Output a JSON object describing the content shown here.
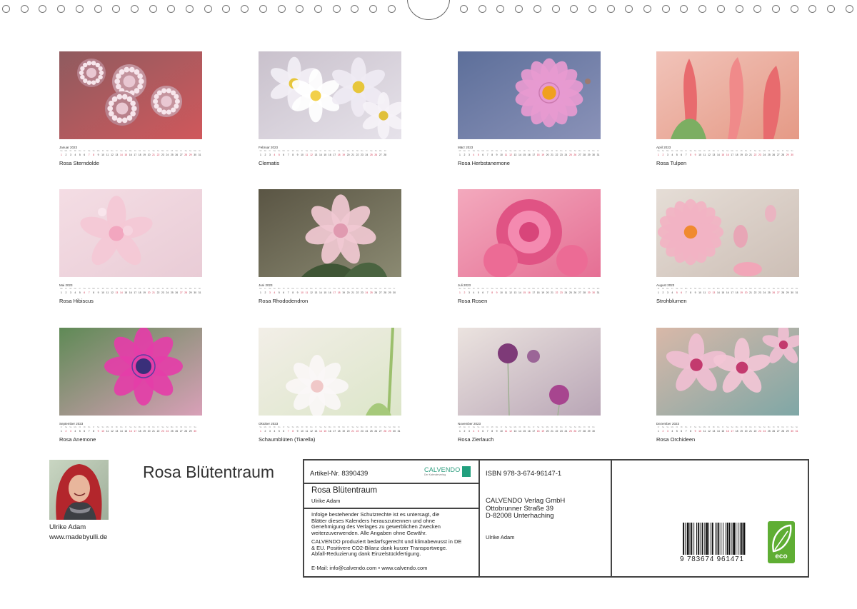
{
  "calendar": {
    "year": "2023",
    "weekday_abbr": [
      "Mo",
      "Di",
      "Mi",
      "Do",
      "Fr",
      "Sa",
      "So"
    ],
    "months": [
      {
        "name": "Januar",
        "days": 31,
        "caption": "Rosa Sterndolde"
      },
      {
        "name": "Februar",
        "days": 28,
        "caption": "Clematis"
      },
      {
        "name": "März",
        "days": 31,
        "caption": "Rosa Herbstanemone"
      },
      {
        "name": "April",
        "days": 30,
        "caption": "Rosa Tulpen"
      },
      {
        "name": "Mai",
        "days": 31,
        "caption": "Rosa Hibiscus"
      },
      {
        "name": "Juni",
        "days": 30,
        "caption": "Rosa Rhododendron"
      },
      {
        "name": "Juli",
        "days": 31,
        "caption": "Rosa Rosen"
      },
      {
        "name": "August",
        "days": 31,
        "caption": "Strohblumen"
      },
      {
        "name": "September",
        "days": 30,
        "caption": "Rosa Anemone"
      },
      {
        "name": "Oktober",
        "days": 31,
        "caption": "Schaumblüten (Tiarella)"
      },
      {
        "name": "November",
        "days": 30,
        "caption": "Rosa Zierlauch"
      },
      {
        "name": "Dezember",
        "days": 31,
        "caption": "Rosa Orchideen"
      }
    ]
  },
  "author": {
    "name": "Ulrike Adam",
    "website": "www.madebyulli.de"
  },
  "title": "Rosa Blütentraum",
  "info": {
    "article": "Artikel-Nr. 8390439",
    "logo": "CALVENDO",
    "logo_sub": "Der Kalenderverlag",
    "title": "Rosa Blütentraum",
    "author": "Ulrike Adam",
    "notice1": [
      "Infolge bestehender Schutzrechte ist es untersagt, die",
      "Blätter dieses Kalenders herauszutrennen und ohne",
      "Genehmigung des Verlages zu gewerblichen Zwecken",
      "weiterzuverwenden. Alle Angaben ohne Gewähr."
    ],
    "notice2": [
      "CALVENDO produziert bedarfsgerecht und klimabewusst in DE",
      "& EU. Positivere CO2-Bilanz dank kurzer Transportwege.",
      "Abfall-Reduzierung dank Einzelstückfertigung."
    ],
    "contact": "E-Mail: info@calvendo.com • www.calvendo.com",
    "isbn": "ISBN 978-3-674-96147-1",
    "publisher": [
      "CALVENDO Verlag GmbH",
      "Ottobrunner Straße 39",
      "D-82008 Unterhaching"
    ],
    "publisher_author": "Ulrike Adam",
    "barcode_digits": "9 783674 961471",
    "eco_label": "eco"
  },
  "colors": {
    "weekend": "#d0324c",
    "calvendo_green": "#22a07e",
    "eco_green": "#5fae34"
  }
}
